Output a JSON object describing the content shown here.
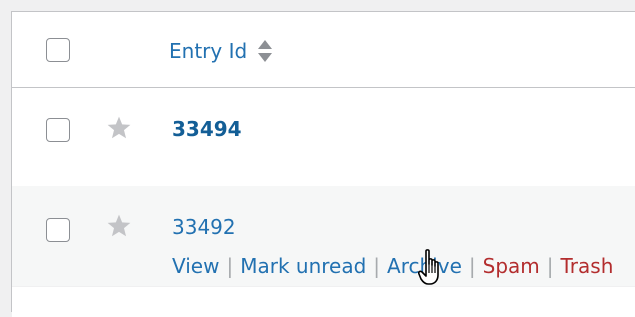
{
  "table": {
    "header": {
      "entry_id_label": "Entry Id"
    },
    "rows": [
      {
        "entry_id": "33494",
        "unread": true
      },
      {
        "entry_id": "33492",
        "unread": false,
        "actions": {
          "view": "View",
          "mark_unread": "Mark unread",
          "archive": "Archive",
          "spam": "Spam",
          "trash": "Trash",
          "separator": "|"
        }
      }
    ]
  },
  "colors": {
    "link": "#2271b1",
    "danger": "#b32d2e",
    "star": "#c3c4c7",
    "row_alt_bg": "#f6f7f7"
  },
  "icons": {
    "sort": "sort-icon",
    "star": "star-icon",
    "cursor": "hand-pointer-cursor"
  }
}
